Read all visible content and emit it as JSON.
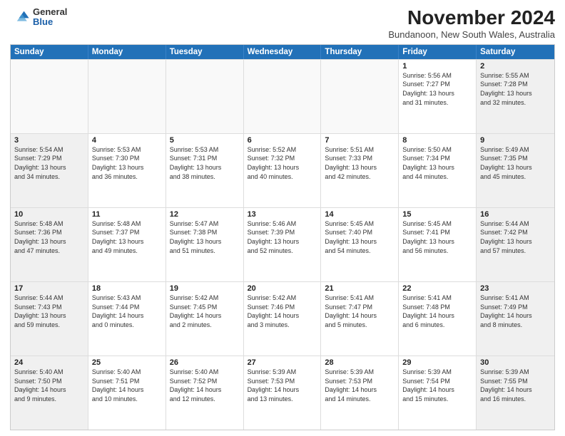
{
  "header": {
    "logo": {
      "general": "General",
      "blue": "Blue"
    },
    "title": "November 2024",
    "location": "Bundanoon, New South Wales, Australia"
  },
  "calendar": {
    "days": [
      "Sunday",
      "Monday",
      "Tuesday",
      "Wednesday",
      "Thursday",
      "Friday",
      "Saturday"
    ],
    "rows": [
      [
        {
          "day": "",
          "info": ""
        },
        {
          "day": "",
          "info": ""
        },
        {
          "day": "",
          "info": ""
        },
        {
          "day": "",
          "info": ""
        },
        {
          "day": "",
          "info": ""
        },
        {
          "day": "1",
          "info": "Sunrise: 5:56 AM\nSunset: 7:27 PM\nDaylight: 13 hours\nand 31 minutes."
        },
        {
          "day": "2",
          "info": "Sunrise: 5:55 AM\nSunset: 7:28 PM\nDaylight: 13 hours\nand 32 minutes."
        }
      ],
      [
        {
          "day": "3",
          "info": "Sunrise: 5:54 AM\nSunset: 7:29 PM\nDaylight: 13 hours\nand 34 minutes."
        },
        {
          "day": "4",
          "info": "Sunrise: 5:53 AM\nSunset: 7:30 PM\nDaylight: 13 hours\nand 36 minutes."
        },
        {
          "day": "5",
          "info": "Sunrise: 5:53 AM\nSunset: 7:31 PM\nDaylight: 13 hours\nand 38 minutes."
        },
        {
          "day": "6",
          "info": "Sunrise: 5:52 AM\nSunset: 7:32 PM\nDaylight: 13 hours\nand 40 minutes."
        },
        {
          "day": "7",
          "info": "Sunrise: 5:51 AM\nSunset: 7:33 PM\nDaylight: 13 hours\nand 42 minutes."
        },
        {
          "day": "8",
          "info": "Sunrise: 5:50 AM\nSunset: 7:34 PM\nDaylight: 13 hours\nand 44 minutes."
        },
        {
          "day": "9",
          "info": "Sunrise: 5:49 AM\nSunset: 7:35 PM\nDaylight: 13 hours\nand 45 minutes."
        }
      ],
      [
        {
          "day": "10",
          "info": "Sunrise: 5:48 AM\nSunset: 7:36 PM\nDaylight: 13 hours\nand 47 minutes."
        },
        {
          "day": "11",
          "info": "Sunrise: 5:48 AM\nSunset: 7:37 PM\nDaylight: 13 hours\nand 49 minutes."
        },
        {
          "day": "12",
          "info": "Sunrise: 5:47 AM\nSunset: 7:38 PM\nDaylight: 13 hours\nand 51 minutes."
        },
        {
          "day": "13",
          "info": "Sunrise: 5:46 AM\nSunset: 7:39 PM\nDaylight: 13 hours\nand 52 minutes."
        },
        {
          "day": "14",
          "info": "Sunrise: 5:45 AM\nSunset: 7:40 PM\nDaylight: 13 hours\nand 54 minutes."
        },
        {
          "day": "15",
          "info": "Sunrise: 5:45 AM\nSunset: 7:41 PM\nDaylight: 13 hours\nand 56 minutes."
        },
        {
          "day": "16",
          "info": "Sunrise: 5:44 AM\nSunset: 7:42 PM\nDaylight: 13 hours\nand 57 minutes."
        }
      ],
      [
        {
          "day": "17",
          "info": "Sunrise: 5:44 AM\nSunset: 7:43 PM\nDaylight: 13 hours\nand 59 minutes."
        },
        {
          "day": "18",
          "info": "Sunrise: 5:43 AM\nSunset: 7:44 PM\nDaylight: 14 hours\nand 0 minutes."
        },
        {
          "day": "19",
          "info": "Sunrise: 5:42 AM\nSunset: 7:45 PM\nDaylight: 14 hours\nand 2 minutes."
        },
        {
          "day": "20",
          "info": "Sunrise: 5:42 AM\nSunset: 7:46 PM\nDaylight: 14 hours\nand 3 minutes."
        },
        {
          "day": "21",
          "info": "Sunrise: 5:41 AM\nSunset: 7:47 PM\nDaylight: 14 hours\nand 5 minutes."
        },
        {
          "day": "22",
          "info": "Sunrise: 5:41 AM\nSunset: 7:48 PM\nDaylight: 14 hours\nand 6 minutes."
        },
        {
          "day": "23",
          "info": "Sunrise: 5:41 AM\nSunset: 7:49 PM\nDaylight: 14 hours\nand 8 minutes."
        }
      ],
      [
        {
          "day": "24",
          "info": "Sunrise: 5:40 AM\nSunset: 7:50 PM\nDaylight: 14 hours\nand 9 minutes."
        },
        {
          "day": "25",
          "info": "Sunrise: 5:40 AM\nSunset: 7:51 PM\nDaylight: 14 hours\nand 10 minutes."
        },
        {
          "day": "26",
          "info": "Sunrise: 5:40 AM\nSunset: 7:52 PM\nDaylight: 14 hours\nand 12 minutes."
        },
        {
          "day": "27",
          "info": "Sunrise: 5:39 AM\nSunset: 7:53 PM\nDaylight: 14 hours\nand 13 minutes."
        },
        {
          "day": "28",
          "info": "Sunrise: 5:39 AM\nSunset: 7:53 PM\nDaylight: 14 hours\nand 14 minutes."
        },
        {
          "day": "29",
          "info": "Sunrise: 5:39 AM\nSunset: 7:54 PM\nDaylight: 14 hours\nand 15 minutes."
        },
        {
          "day": "30",
          "info": "Sunrise: 5:39 AM\nSunset: 7:55 PM\nDaylight: 14 hours\nand 16 minutes."
        }
      ]
    ]
  }
}
